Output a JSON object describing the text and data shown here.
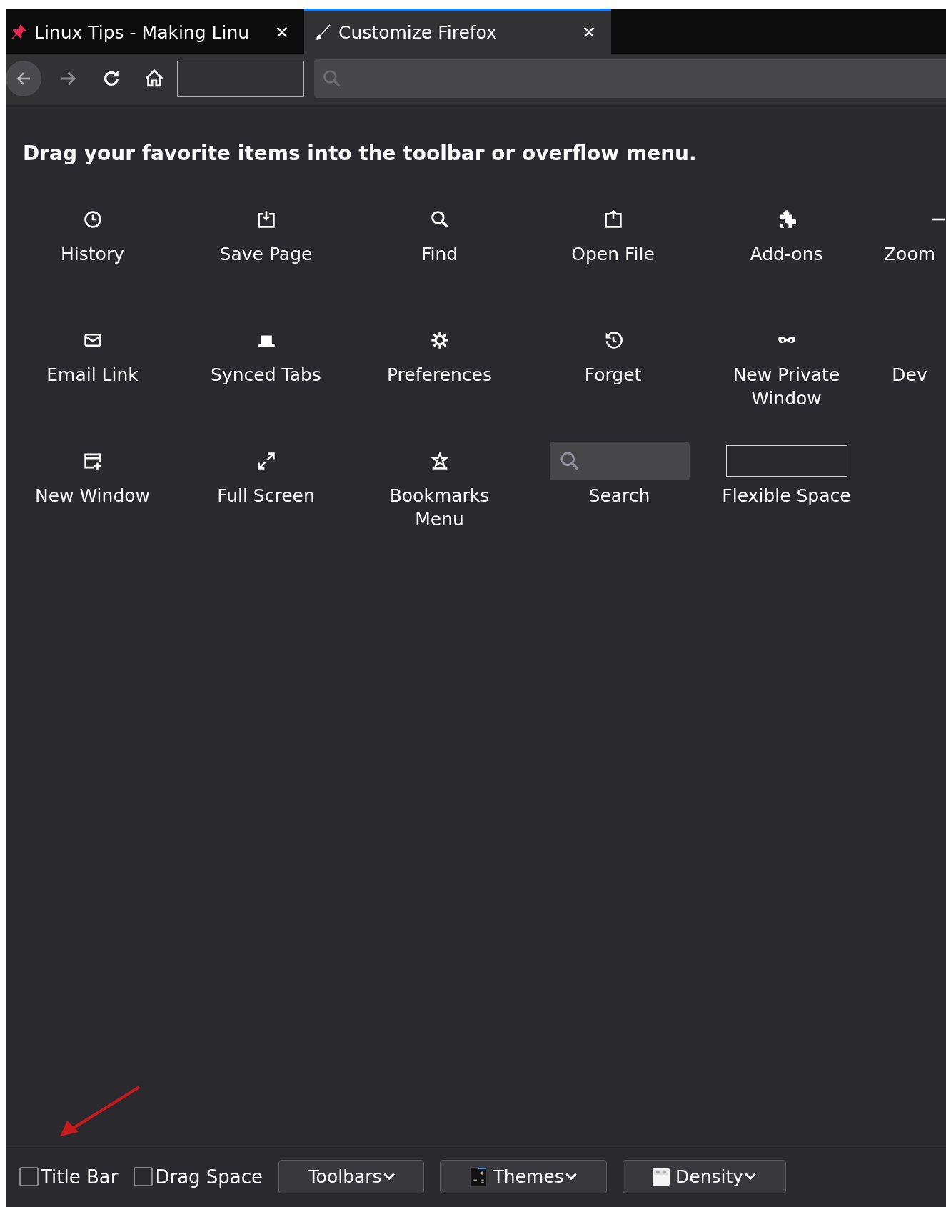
{
  "tabs": [
    {
      "label": "Linux Tips - Making Linu",
      "selected": false
    },
    {
      "label": "Customize Firefox",
      "selected": true
    }
  ],
  "toolbar": {
    "back_disabled": false,
    "forward_disabled": true
  },
  "heading": "Drag your favorite items into the toolbar or overflow menu.",
  "items": [
    {
      "label": "History"
    },
    {
      "label": "Save Page"
    },
    {
      "label": "Find"
    },
    {
      "label": "Open File"
    },
    {
      "label": "Add-ons"
    },
    {
      "label": "Zoom"
    },
    {
      "label": "Email Link"
    },
    {
      "label": "Synced Tabs"
    },
    {
      "label": "Preferences"
    },
    {
      "label": "Forget"
    },
    {
      "label": "New Private Window"
    },
    {
      "label": "Dev"
    },
    {
      "label": "New Window"
    },
    {
      "label": "Full Screen"
    },
    {
      "label": "Bookmarks Menu"
    },
    {
      "label": "Search"
    },
    {
      "label": "Flexible Space"
    }
  ],
  "footer": {
    "checkboxes": [
      {
        "label": "Title Bar",
        "checked": false
      },
      {
        "label": "Drag Space",
        "checked": false
      }
    ],
    "menus": [
      {
        "label": "Toolbars"
      },
      {
        "label": "Themes"
      },
      {
        "label": "Density"
      }
    ]
  }
}
